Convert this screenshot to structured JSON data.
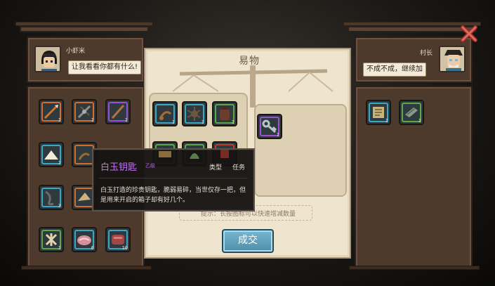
{
  "title": "易物",
  "left_npc": {
    "name": "小虾米",
    "speech": "让我看看你都有什么!"
  },
  "right_npc": {
    "name": "村长",
    "speech": "不成不成，继续加"
  },
  "inventory": [
    {
      "icon": "spear-icon",
      "rarity": "orange",
      "count": "1"
    },
    {
      "icon": "crossbow-icon",
      "rarity": "orange",
      "count": "1"
    },
    {
      "icon": "staff-icon",
      "rarity": "purple",
      "count": "1"
    },
    {
      "icon": "salt-pile-icon",
      "rarity": "blue",
      "count": "1"
    },
    {
      "icon": "scorpion-icon",
      "rarity": "orange",
      "count": ""
    },
    {
      "icon": "chain-icon",
      "rarity": "blue",
      "count": "3"
    },
    {
      "icon": "fan-icon",
      "rarity": "orange",
      "count": ""
    },
    {
      "icon": "bones-icon",
      "rarity": "green",
      "count": "1"
    },
    {
      "icon": "meat-icon",
      "rarity": "blue",
      "count": "6"
    },
    {
      "icon": "raw-meat-icon",
      "rarity": "blue",
      "count": "10"
    }
  ],
  "offer_items": [
    {
      "icon": "scorpion-icon",
      "rarity": "blue",
      "count": "1"
    },
    {
      "icon": "spider-icon",
      "rarity": "blue",
      "count": "1"
    },
    {
      "icon": "bag-icon",
      "rarity": "green",
      "count": "1"
    },
    {
      "icon": "cloth-icon",
      "rarity": "green",
      "count": ""
    },
    {
      "icon": "green-herb-icon",
      "rarity": "green",
      "count": ""
    },
    {
      "icon": "red-item-icon",
      "rarity": "red",
      "count": ""
    }
  ],
  "request_items": [
    {
      "icon": "key-icon",
      "rarity": "purple",
      "count": "1"
    }
  ],
  "right_inventory": [
    {
      "icon": "scroll-icon",
      "rarity": "blue",
      "count": "1"
    },
    {
      "icon": "book-icon",
      "rarity": "green",
      "count": "1"
    }
  ],
  "tooltip": {
    "name": "白玉钥匙",
    "grade": "乙级",
    "type_label": "类型",
    "type_value": "任务",
    "description": "白玉打造的珍贵钥匙，脆弱易碎，当世仅存一把，但是用来开启的箱子却有好几个。"
  },
  "hint": "提示：长按图标可以快速增减数量",
  "deal_button": "成交"
}
